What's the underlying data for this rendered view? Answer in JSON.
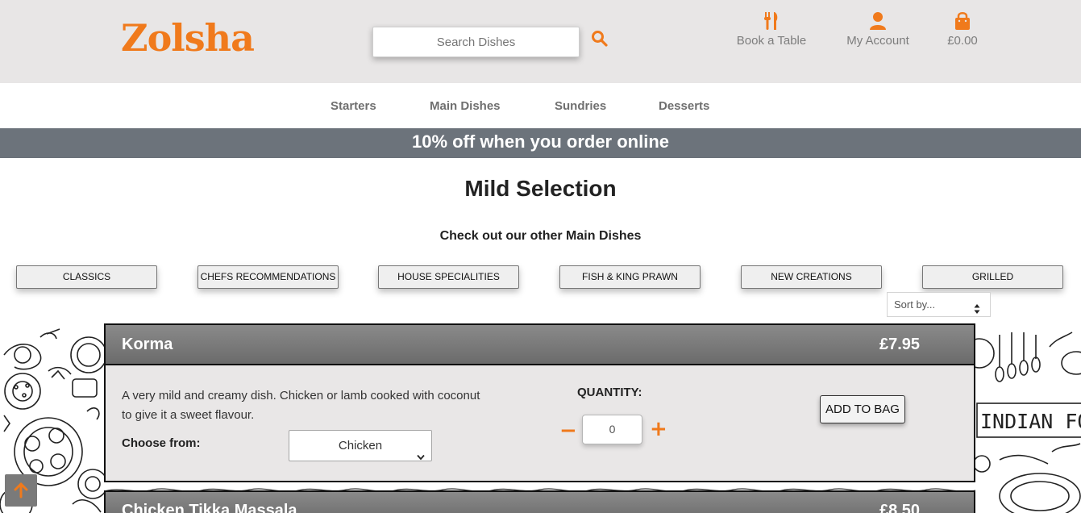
{
  "brand": {
    "logo_text": "Zolsha",
    "accent_color": "#f07a1c"
  },
  "header": {
    "search_placeholder": "Search Dishes",
    "search_icon": "search-icon",
    "book_table": {
      "label": "Book a Table",
      "icon": "utensils-icon"
    },
    "my_account": {
      "label": "My Account",
      "icon": "user-icon"
    },
    "bag": {
      "label": "£0.00",
      "icon": "shopping-bag-icon"
    }
  },
  "nav": {
    "items": [
      "Starters",
      "Main Dishes",
      "Sundries",
      "Desserts"
    ]
  },
  "promo": {
    "text": "10% off when you order online",
    "background": "#6c737b"
  },
  "page": {
    "title": "Mild Selection",
    "subtitle": "Check out our other Main Dishes"
  },
  "categories": [
    "CLASSICS",
    "CHEFS RECOMMENDATIONS",
    "HOUSE SPECIALITIES",
    "FISH & KING PRAWN",
    "NEW CREATIONS",
    "GRILLED"
  ],
  "sort": {
    "selected": "Sort by..."
  },
  "dishes": [
    {
      "name": "Korma",
      "price": "£7.95",
      "description": "A very mild and creamy dish. Chicken or lamb cooked with coconut to give it a sweet flavour.",
      "choose_label": "Choose from:",
      "choose_selected": "Chicken",
      "quantity_label": "QUANTITY:",
      "quantity_value": "0",
      "add_label": "ADD TO BAG"
    },
    {
      "name": "Chicken Tikka Massala",
      "price": "£8.50"
    }
  ],
  "decor": {
    "right_doodle_text": "INDIAN FO"
  },
  "scroll_top": {
    "icon": "arrow-up-icon"
  }
}
